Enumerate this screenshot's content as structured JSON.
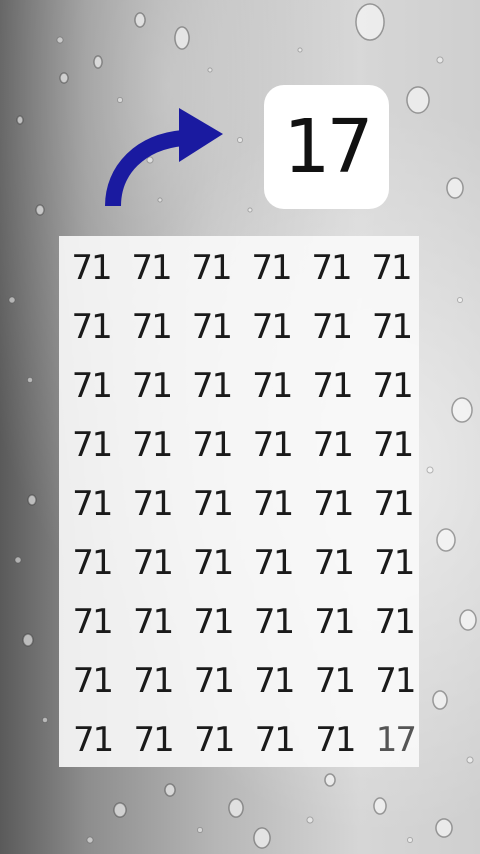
{
  "target": {
    "number": "17"
  },
  "grid": {
    "rows": [
      [
        "71",
        "71",
        "71",
        "71",
        "71",
        "71"
      ],
      [
        "71",
        "71",
        "71",
        "71",
        "71",
        "71"
      ],
      [
        "71",
        "71",
        "71",
        "71",
        "71",
        "71"
      ],
      [
        "71",
        "71",
        "71",
        "71",
        "71",
        "71"
      ],
      [
        "71",
        "71",
        "71",
        "71",
        "71",
        "71"
      ],
      [
        "71",
        "71",
        "71",
        "71",
        "71",
        "71"
      ],
      [
        "71",
        "71",
        "71",
        "71",
        "71",
        "71"
      ],
      [
        "71",
        "71",
        "71",
        "71",
        "71",
        "71"
      ],
      [
        "71",
        "71",
        "71",
        "71",
        "71",
        "17"
      ]
    ]
  },
  "colors": {
    "arrow": "#1a1aa0",
    "panel": "#fafafa",
    "text": "#1a1a1a"
  },
  "icons": {
    "pointer": "curved-arrow-icon"
  }
}
